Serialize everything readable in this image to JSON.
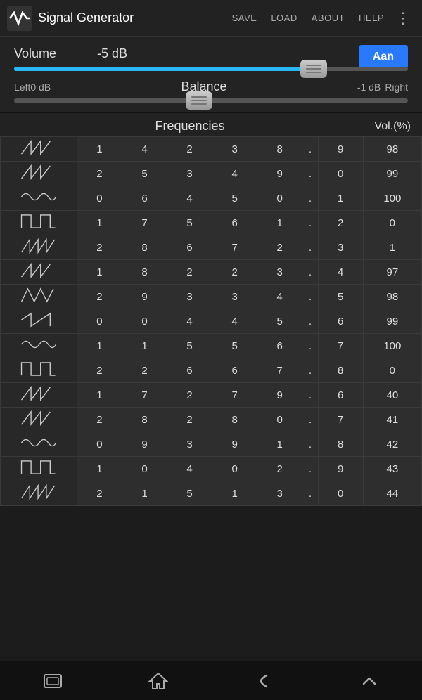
{
  "app": {
    "title": "Signal Generator",
    "icon": "~"
  },
  "toolbar": {
    "save": "SAVE",
    "load": "LOAD",
    "about": "ABOUT",
    "help": "HELP"
  },
  "controls": {
    "aan_label": "Aan",
    "volume_label": "Volume",
    "volume_value": "-5 dB",
    "balance_label": "Balance",
    "balance_value": "-1 dB",
    "balance_left": "Left",
    "balance_right": "Right",
    "balance_left_db": "0 dB"
  },
  "freq_section": {
    "title": "Frequencies",
    "vol_pct": "Vol.(%)"
  },
  "rows": [
    {
      "wave": "sawtooth",
      "digits": [
        "1",
        "4",
        "2",
        "3",
        "8"
      ],
      "dot": ".",
      "extra": "9",
      "vol": "98"
    },
    {
      "wave": "sawtooth",
      "digits": [
        "2",
        "5",
        "3",
        "4",
        "9"
      ],
      "dot": ".",
      "extra": "0",
      "vol": "99"
    },
    {
      "wave": "sine",
      "digits": [
        "0",
        "6",
        "4",
        "5",
        "0"
      ],
      "dot": ".",
      "extra": "1",
      "vol": "100"
    },
    {
      "wave": "square",
      "digits": [
        "1",
        "7",
        "5",
        "6",
        "1"
      ],
      "dot": ".",
      "extra": "2",
      "vol": "0"
    },
    {
      "wave": "sawtooth2",
      "digits": [
        "2",
        "8",
        "6",
        "7",
        "2"
      ],
      "dot": ".",
      "extra": "3",
      "vol": "1"
    },
    {
      "wave": "sawtooth",
      "digits": [
        "1",
        "8",
        "2",
        "2",
        "3"
      ],
      "dot": ".",
      "extra": "4",
      "vol": "97"
    },
    {
      "wave": "zigzag",
      "digits": [
        "2",
        "9",
        "3",
        "3",
        "4"
      ],
      "dot": ".",
      "extra": "5",
      "vol": "98"
    },
    {
      "wave": "sawtooth3",
      "digits": [
        "0",
        "0",
        "4",
        "4",
        "5"
      ],
      "dot": ".",
      "extra": "6",
      "vol": "99"
    },
    {
      "wave": "sine",
      "digits": [
        "1",
        "1",
        "5",
        "5",
        "6"
      ],
      "dot": ".",
      "extra": "7",
      "vol": "100"
    },
    {
      "wave": "square",
      "digits": [
        "2",
        "2",
        "6",
        "6",
        "7"
      ],
      "dot": ".",
      "extra": "8",
      "vol": "0"
    },
    {
      "wave": "sawtooth",
      "digits": [
        "1",
        "7",
        "2",
        "7",
        "9"
      ],
      "dot": ".",
      "extra": "6",
      "vol": "40"
    },
    {
      "wave": "sawtooth",
      "digits": [
        "2",
        "8",
        "2",
        "8",
        "0"
      ],
      "dot": ".",
      "extra": "7",
      "vol": "41"
    },
    {
      "wave": "sine",
      "digits": [
        "0",
        "9",
        "3",
        "9",
        "1"
      ],
      "dot": ".",
      "extra": "8",
      "vol": "42"
    },
    {
      "wave": "square",
      "digits": [
        "1",
        "0",
        "4",
        "0",
        "2"
      ],
      "dot": ".",
      "extra": "9",
      "vol": "43"
    },
    {
      "wave": "sawtooth2",
      "digits": [
        "2",
        "1",
        "5",
        "1",
        "3"
      ],
      "dot": ".",
      "extra": "0",
      "vol": "44"
    }
  ]
}
